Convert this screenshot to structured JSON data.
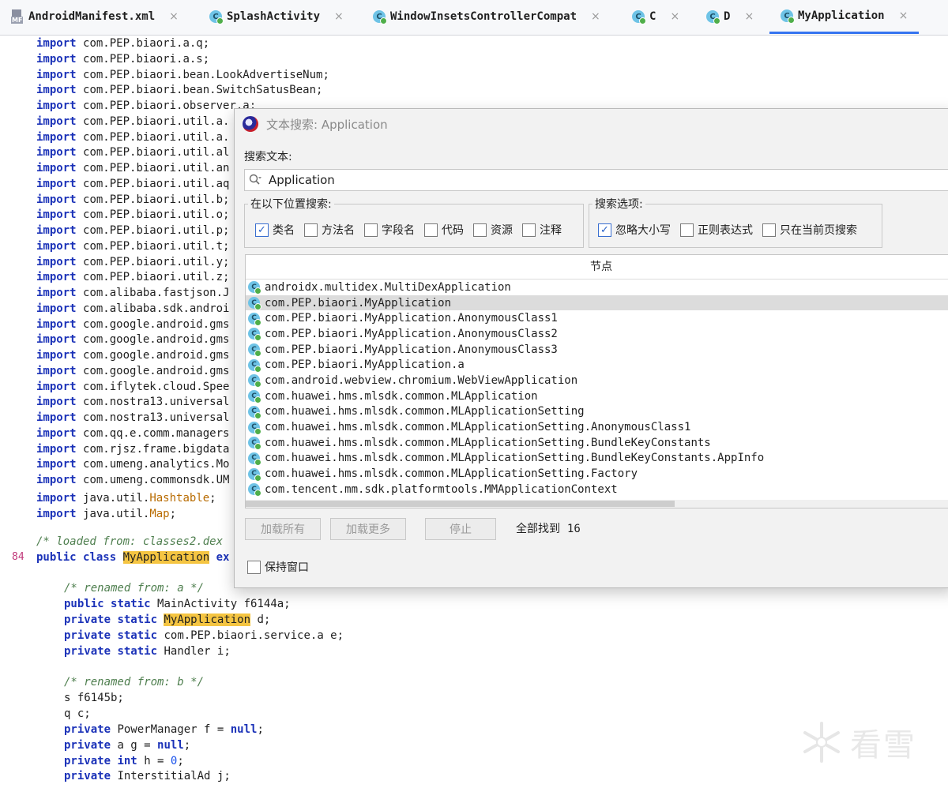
{
  "tabs": [
    {
      "label": "AndroidManifest.xml",
      "icon": "manifest-file-icon",
      "active": false
    },
    {
      "label": "SplashActivity",
      "icon": "class-icon",
      "active": false
    },
    {
      "label": "WindowInsetsControllerCompat",
      "icon": "class-icon",
      "active": false
    },
    {
      "label": "C",
      "icon": "class-icon",
      "active": false
    },
    {
      "label": "D",
      "icon": "class-icon",
      "active": false
    },
    {
      "label": "MyApplication",
      "icon": "class-icon",
      "active": true
    }
  ],
  "tab_close_glyph": "×",
  "class_icon_letter": "C",
  "manifest_icon_label": "MF",
  "code": {
    "import_kw": "import",
    "imports": [
      "com.PEP.biaori.a.q;",
      "com.PEP.biaori.a.s;",
      "com.PEP.biaori.bean.LookAdvertiseNum;",
      "com.PEP.biaori.bean.SwitchSatusBean;",
      "com.PEP.biaori.observer.a;",
      "com.PEP.biaori.util.a.",
      "com.PEP.biaori.util.a.",
      "com.PEP.biaori.util.al",
      "com.PEP.biaori.util.an",
      "com.PEP.biaori.util.aq",
      "com.PEP.biaori.util.b;",
      "com.PEP.biaori.util.o;",
      "com.PEP.biaori.util.p;",
      "com.PEP.biaori.util.t;",
      "com.PEP.biaori.util.y;",
      "com.PEP.biaori.util.z;",
      "com.alibaba.fastjson.J",
      "com.alibaba.sdk.androi",
      "com.google.android.gms",
      "com.google.android.gms",
      "com.google.android.gms",
      "com.google.android.gms",
      "com.iflytek.cloud.Spee",
      "com.nostra13.universal",
      "com.nostra13.universal",
      "com.qq.e.comm.managers",
      "com.rjsz.frame.bigdata",
      "com.umeng.analytics.Mo",
      "com.umeng.commonsdk.UM"
    ],
    "import_hashtable_pkg": "java.util.",
    "import_hashtable_cls": "Hashtable",
    "import_map_pkg": "java.util.",
    "import_map_cls": "Map",
    "semicolon": ";",
    "comment_loaded": "/* loaded from: classes2.dex",
    "line_number": "84",
    "kw_public": "public",
    "kw_class": "class",
    "class_name": "MyApplication",
    "ext_fragment": "ex",
    "comment_renamed_a": "/* renamed from: a */",
    "kw_static": "static",
    "kw_private": "private",
    "field_mainactivity": "MainActivity f6144a;",
    "field_d_type": "MyApplication",
    "field_d_name": "d;",
    "field_e": "com.PEP.biaori.service.a e;",
    "field_i": "Handler i;",
    "comment_renamed_b": "/* renamed from: b */",
    "field_s": "s f6145b;",
    "field_q": "q c;",
    "field_f": "PowerManager f = ",
    "kw_null": "null",
    "field_g": "a g = ",
    "kw_int": "int",
    "field_h": "h = ",
    "num_zero": "0",
    "field_j": "InterstitialAd j;"
  },
  "dialog": {
    "title": "文本搜索: Application",
    "search_label": "搜索文本:",
    "search_value": "Application",
    "scope_legend": "在以下位置搜索:",
    "scope_options": [
      {
        "label": "类名",
        "checked": true
      },
      {
        "label": "方法名",
        "checked": false
      },
      {
        "label": "字段名",
        "checked": false
      },
      {
        "label": "代码",
        "checked": false
      },
      {
        "label": "资源",
        "checked": false
      },
      {
        "label": "注释",
        "checked": false
      }
    ],
    "options_legend": "搜索选项:",
    "search_options": [
      {
        "label": "忽略大小写",
        "checked": true
      },
      {
        "label": "正则表达式",
        "checked": false
      },
      {
        "label": "只在当前页搜索",
        "checked": false
      }
    ],
    "results_header": "节点",
    "results": [
      "androidx.multidex.MultiDexApplication",
      "com.PEP.biaori.MyApplication",
      "com.PEP.biaori.MyApplication.AnonymousClass1",
      "com.PEP.biaori.MyApplication.AnonymousClass2",
      "com.PEP.biaori.MyApplication.AnonymousClass3",
      "com.PEP.biaori.MyApplication.a",
      "com.android.webview.chromium.WebViewApplication",
      "com.huawei.hms.mlsdk.common.MLApplication",
      "com.huawei.hms.mlsdk.common.MLApplicationSetting",
      "com.huawei.hms.mlsdk.common.MLApplicationSetting.AnonymousClass1",
      "com.huawei.hms.mlsdk.common.MLApplicationSetting.BundleKeyConstants",
      "com.huawei.hms.mlsdk.common.MLApplicationSetting.BundleKeyConstants.AppInfo",
      "com.huawei.hms.mlsdk.common.MLApplicationSetting.Factory",
      "com.tencent.mm.sdk.platformtools.MMApplicationContext"
    ],
    "selected_result_index": 1,
    "btn_load_all": "加载所有",
    "btn_load_more": "加载更多",
    "btn_stop": "停止",
    "found_label": "全部找到",
    "found_count": "16",
    "keep_window_label": "保持窗口",
    "keep_window_checked": false
  },
  "watermark": {
    "text": "看雪",
    "icon": "snowflake-logo-icon"
  },
  "colors": {
    "keyword": "#1b32b8",
    "comment": "#4f7f4f",
    "highlight": "#f5c542",
    "active_tab": "#3574f0"
  }
}
